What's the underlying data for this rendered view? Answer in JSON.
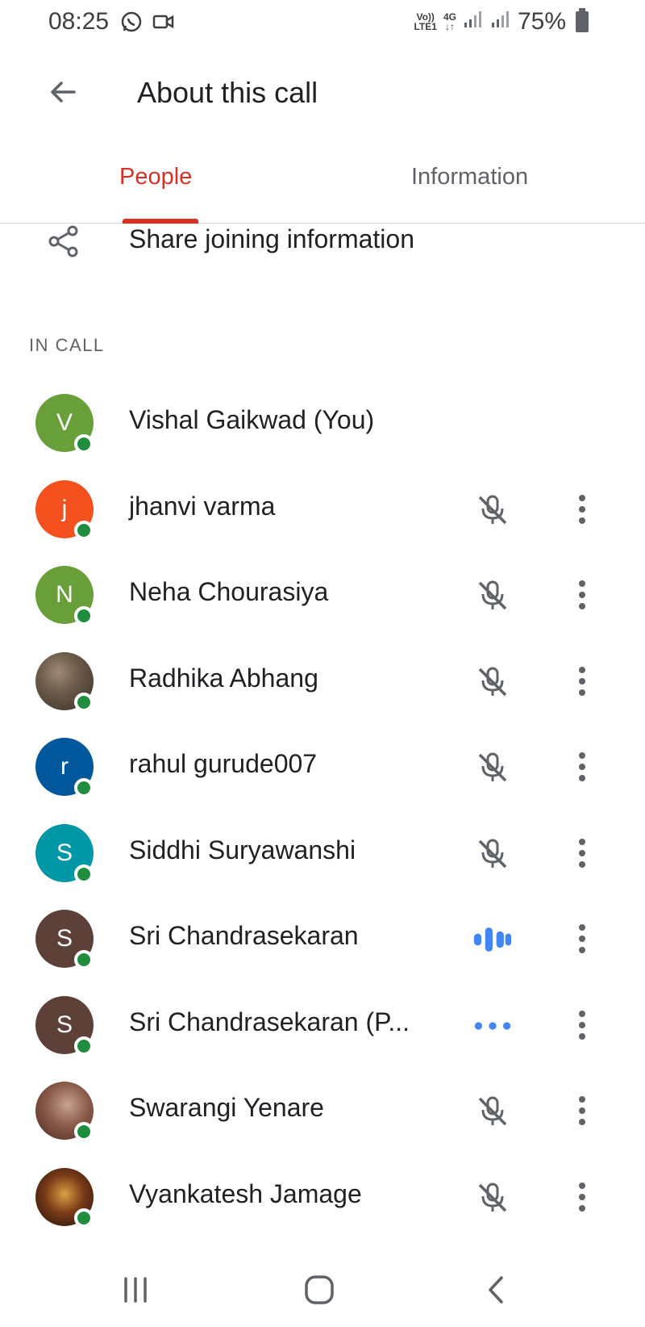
{
  "status_bar": {
    "time": "08:25",
    "network_top": "Vo))",
    "network_bottom": "LTE1",
    "data_top": "4G",
    "data_bottom": "↓↑",
    "battery": "75%",
    "icons": [
      "whatsapp-icon",
      "video-camera-icon",
      "signal-icon",
      "signal-icon",
      "battery-icon"
    ]
  },
  "header": {
    "title": "About this call",
    "back_icon": "arrow-back-icon"
  },
  "tabs": [
    {
      "label": "People",
      "active": true
    },
    {
      "label": "Information",
      "active": false
    }
  ],
  "share": {
    "label": "Share joining information",
    "icon": "share-icon"
  },
  "section_label": "IN CALL",
  "participants": [
    {
      "name": "Vishal Gaikwad (You)",
      "initial": "V",
      "avatar_color": "#689f38",
      "status": "none"
    },
    {
      "name": "jhanvi varma",
      "initial": "j",
      "avatar_color": "#f4511e",
      "status": "muted"
    },
    {
      "name": "Neha Chourasiya",
      "initial": "N",
      "avatar_color": "#689f38",
      "status": "muted"
    },
    {
      "name": "Radhika Abhang",
      "initial": "",
      "avatar_color": "photo",
      "status": "muted"
    },
    {
      "name": "rahul gurude007",
      "initial": "r",
      "avatar_color": "#01579b",
      "status": "muted"
    },
    {
      "name": "Siddhi Suryawanshi",
      "initial": "S",
      "avatar_color": "#0097a7",
      "status": "muted"
    },
    {
      "name": "Sri Chandrasekaran",
      "initial": "S",
      "avatar_color": "#5d4037",
      "status": "speaking"
    },
    {
      "name": "Sri Chandrasekaran (P...",
      "initial": "S",
      "avatar_color": "#5d4037",
      "status": "connecting"
    },
    {
      "name": "Swarangi Yenare",
      "initial": "",
      "avatar_color": "photo",
      "status": "muted"
    },
    {
      "name": "Vyankatesh Jamage",
      "initial": "",
      "avatar_color": "photo",
      "status": "muted"
    }
  ],
  "colors": {
    "accent": "#d93025",
    "presence": "#1e8e3e",
    "speaking": "#4285f4"
  },
  "nav_bar": {
    "icons": [
      "recents-icon",
      "home-icon",
      "back-icon"
    ]
  }
}
